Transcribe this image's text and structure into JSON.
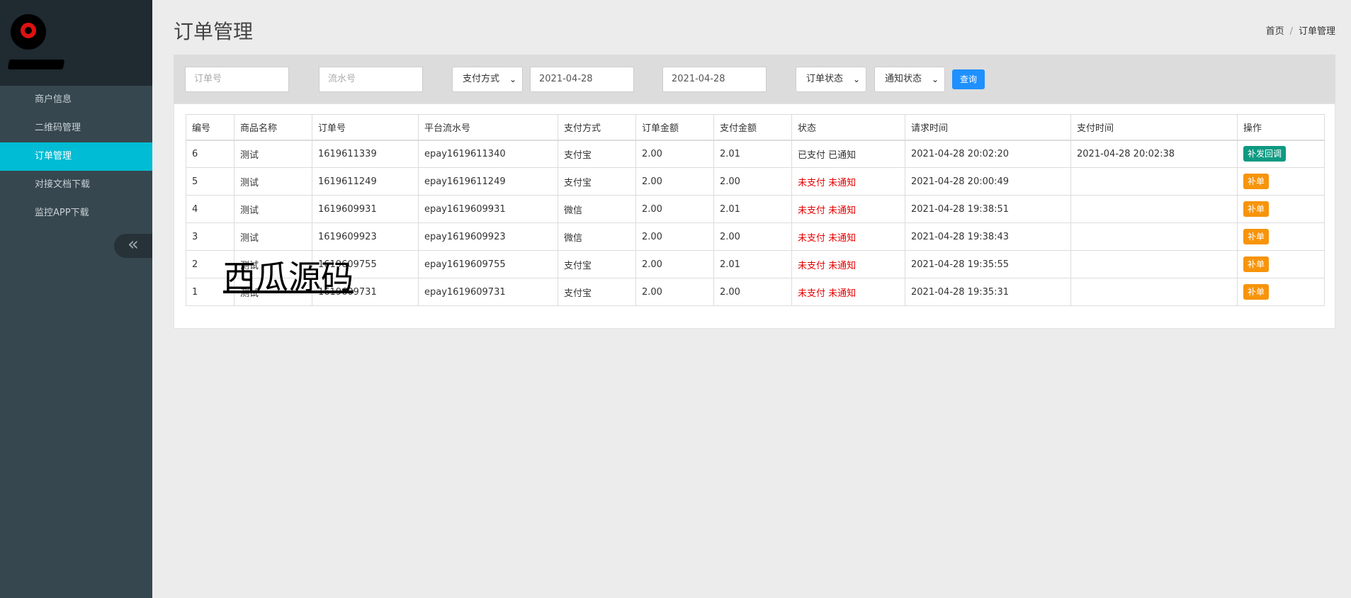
{
  "sidebar": {
    "items": [
      {
        "label": "商户信息"
      },
      {
        "label": "二维码管理"
      },
      {
        "label": "订单管理"
      },
      {
        "label": "对接文档下载"
      },
      {
        "label": "监控APP下载"
      }
    ],
    "collapse_glyph": "«"
  },
  "header": {
    "title": "订单管理",
    "breadcrumb": [
      "首页",
      "订单管理"
    ],
    "breadcrumb_sep": "/"
  },
  "filters": {
    "order_no_placeholder": "订单号",
    "serial_no_placeholder": "流水号",
    "pay_method": "支付方式",
    "date_start": "2021-04-28",
    "date_end": "2021-04-28",
    "order_status": "订单状态",
    "notify_status": "通知状态",
    "query_label": "查询"
  },
  "table": {
    "headers": [
      "编号",
      "商品名称",
      "订单号",
      "平台流水号",
      "支付方式",
      "订单金额",
      "支付金额",
      "状态",
      "请求时间",
      "支付时间",
      "操作"
    ],
    "rows": [
      {
        "id": "6",
        "product": "测试",
        "order_no": "1619611339",
        "serial": "epay1619611340",
        "method": "支付宝",
        "amount": "2.00",
        "paid": "2.01",
        "status": "已支付 已通知",
        "status_color": "#333333",
        "req_time": "2021-04-28 20:02:20",
        "pay_time": "2021-04-28 20:02:38",
        "op": "补发回调",
        "op_color": "#0e9a82"
      },
      {
        "id": "5",
        "product": "测试",
        "order_no": "1619611249",
        "serial": "epay1619611249",
        "method": "支付宝",
        "amount": "2.00",
        "paid": "2.00",
        "status": "未支付 未通知",
        "status_color": "#e60000",
        "req_time": "2021-04-28 20:00:49",
        "pay_time": "",
        "op": "补单",
        "op_color": "#f7940a"
      },
      {
        "id": "4",
        "product": "测试",
        "order_no": "1619609931",
        "serial": "epay1619609931",
        "method": "微信",
        "amount": "2.00",
        "paid": "2.01",
        "status": "未支付 未通知",
        "status_color": "#e60000",
        "req_time": "2021-04-28 19:38:51",
        "pay_time": "",
        "op": "补单",
        "op_color": "#f7940a"
      },
      {
        "id": "3",
        "product": "测试",
        "order_no": "1619609923",
        "serial": "epay1619609923",
        "method": "微信",
        "amount": "2.00",
        "paid": "2.00",
        "status": "未支付 未通知",
        "status_color": "#e60000",
        "req_time": "2021-04-28 19:38:43",
        "pay_time": "",
        "op": "补单",
        "op_color": "#f7940a"
      },
      {
        "id": "2",
        "product": "测试",
        "order_no": "1619609755",
        "serial": "epay1619609755",
        "method": "支付宝",
        "amount": "2.00",
        "paid": "2.01",
        "status": "未支付 未通知",
        "status_color": "#e60000",
        "req_time": "2021-04-28 19:35:55",
        "pay_time": "",
        "op": "补单",
        "op_color": "#f7940a"
      },
      {
        "id": "1",
        "product": "测试",
        "order_no": "1619609731",
        "serial": "epay1619609731",
        "method": "支付宝",
        "amount": "2.00",
        "paid": "2.00",
        "status": "未支付 未通知",
        "status_color": "#e60000",
        "req_time": "2021-04-28 19:35:31",
        "pay_time": "",
        "op": "补单",
        "op_color": "#f7940a"
      }
    ]
  },
  "watermark": "西瓜源码"
}
